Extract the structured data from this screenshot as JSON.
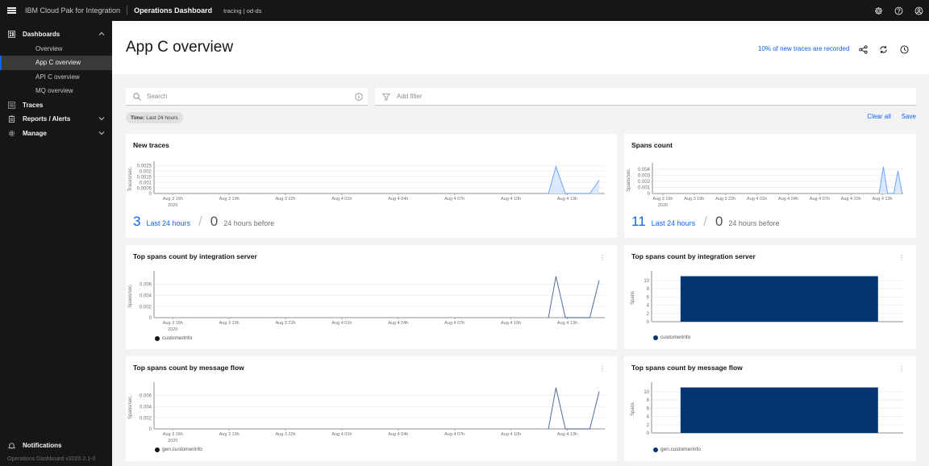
{
  "topbar": {
    "brand": "IBM Cloud Pak for Integration",
    "app_name": "Operations Dashboard",
    "context": "tracing | od-ds",
    "icons": [
      "settings-icon",
      "help-icon",
      "user-icon"
    ]
  },
  "sidebar": {
    "items": [
      {
        "label": "Dashboards",
        "icon": "dashboard-icon",
        "expanded": true,
        "children": [
          {
            "label": "Overview",
            "active": false
          },
          {
            "label": "App C overview",
            "active": true
          },
          {
            "label": "API C overview",
            "active": false
          },
          {
            "label": "MQ overview",
            "active": false
          }
        ]
      },
      {
        "label": "Traces",
        "icon": "traces-icon"
      },
      {
        "label": "Reports / Alerts",
        "icon": "clipboard-icon",
        "expanded": false
      },
      {
        "label": "Manage",
        "icon": "gear-icon",
        "expanded": false
      }
    ],
    "notifications": "Notifications",
    "version": "Operations Dashboard v2020.2.1-0"
  },
  "header": {
    "title": "App C overview",
    "recording_note": "10% of new traces are recorded"
  },
  "toolbar": {
    "search_placeholder": "Search",
    "filter_placeholder": "Add filter",
    "time_tag_key": "Time:",
    "time_tag_value": "Last 24 hours",
    "clear_all": "Clear all",
    "save": "Save"
  },
  "cards": {
    "new_traces": {
      "title": "New traces",
      "count_last": "3",
      "count_last_label": "Last 24 hours",
      "count_before": "0",
      "count_before_label": "24 hours before"
    },
    "spans_count": {
      "title": "Spans count",
      "count_last": "11",
      "count_last_label": "Last 24 hours",
      "count_before": "0",
      "count_before_label": "24 hours before"
    },
    "top_is_line": {
      "title": "Top spans count by integration server",
      "legend": "customerinfo"
    },
    "top_is_bar": {
      "title": "Top spans count by integration server",
      "legend": "customerinfo"
    },
    "top_mf_line": {
      "title": "Top spans count by message flow",
      "legend": "gen.customerinfo"
    },
    "top_mf_bar": {
      "title": "Top spans count by message flow",
      "legend": "gen.customerinfo"
    }
  },
  "colors": {
    "accent": "#0f62fe",
    "area_line": "#6ea6ff",
    "area_fill": "#dbe8fd",
    "series_line": "#4b6e9a",
    "bar": "#033670"
  },
  "chart_data": [
    {
      "id": "new_traces",
      "type": "area",
      "title": "New traces",
      "ylabel": "Traces/sec.",
      "xlabel": "",
      "x_ticks": [
        "Aug 3 16h\n2020",
        "Aug 3 19h",
        "Aug 3 22h",
        "Aug 4 01h",
        "Aug 4 04h",
        "Aug 4 07h",
        "Aug 4 10h",
        "Aug 4 13h"
      ],
      "y_ticks": [
        "0",
        "0.0005",
        "0.001",
        "0.0015",
        "0.002",
        "0.0025"
      ],
      "ylim": [
        0,
        0.0026
      ],
      "x_hours_range": [
        15,
        39
      ],
      "series": [
        {
          "name": "traces",
          "points": [
            [
              36.0,
              0
            ],
            [
              36.4,
              0.0024
            ],
            [
              36.9,
              0
            ],
            [
              38.2,
              0
            ],
            [
              38.7,
              0.0012
            ]
          ]
        }
      ]
    },
    {
      "id": "spans_count",
      "type": "area",
      "title": "Spans count",
      "ylabel": "Spans/sec.",
      "xlabel": "",
      "x_ticks": [
        "Aug 3 16h\n2020",
        "Aug 3 19h",
        "Aug 3 22h",
        "Aug 4 01h",
        "Aug 4 04h",
        "Aug 4 07h",
        "Aug 4 10h",
        "Aug 4 13h"
      ],
      "y_ticks": [
        "0",
        "0.001",
        "0.002",
        "0.003",
        "0.004"
      ],
      "ylim": [
        0,
        0.0045
      ],
      "x_hours_range": [
        15,
        39
      ],
      "series": [
        {
          "name": "spans",
          "points": [
            [
              36.7,
              0
            ],
            [
              37.1,
              0.0044
            ],
            [
              37.5,
              0
            ],
            [
              38.1,
              0
            ],
            [
              38.5,
              0.0037
            ],
            [
              38.9,
              0
            ]
          ]
        }
      ]
    },
    {
      "id": "top_is_line",
      "type": "line",
      "title": "Top spans count by integration server",
      "ylabel": "Spans/sec.",
      "xlabel": "",
      "x_ticks": [
        "Aug 3 16h\n2020",
        "Aug 3 19h",
        "Aug 3 22h",
        "Aug 4 01h",
        "Aug 4 04h",
        "Aug 4 07h",
        "Aug 4 10h",
        "Aug 4 13h"
      ],
      "y_ticks": [
        "0",
        "0.002",
        "0.004",
        "0.006"
      ],
      "ylim": [
        0,
        0.0078
      ],
      "x_hours_range": [
        15,
        39
      ],
      "legend": "bottom-left",
      "series": [
        {
          "name": "customerinfo",
          "points": [
            [
              36.0,
              0
            ],
            [
              36.4,
              0.0074
            ],
            [
              36.9,
              0
            ],
            [
              38.2,
              0
            ],
            [
              38.7,
              0.0067
            ]
          ]
        }
      ]
    },
    {
      "id": "top_is_bar",
      "type": "bar",
      "title": "Top spans count by integration server",
      "ylabel": "Spans",
      "xlabel": "",
      "categories": [
        "customerinfo"
      ],
      "values": [
        11
      ],
      "y_ticks": [
        "0",
        "2",
        "4",
        "6",
        "8",
        "10"
      ],
      "ylim": [
        0,
        11.5
      ],
      "legend": "bottom-left"
    },
    {
      "id": "top_mf_line",
      "type": "line",
      "title": "Top spans count by message flow",
      "ylabel": "Spans/sec.",
      "xlabel": "",
      "x_ticks": [
        "Aug 3 16h\n2020",
        "Aug 3 19h",
        "Aug 3 22h",
        "Aug 4 01h",
        "Aug 4 04h",
        "Aug 4 07h",
        "Aug 4 10h",
        "Aug 4 13h"
      ],
      "y_ticks": [
        "0",
        "0.002",
        "0.004",
        "0.006"
      ],
      "ylim": [
        0,
        0.0078
      ],
      "x_hours_range": [
        15,
        39
      ],
      "legend": "bottom-left",
      "series": [
        {
          "name": "gen.customerinfo",
          "points": [
            [
              36.0,
              0
            ],
            [
              36.4,
              0.0074
            ],
            [
              36.9,
              0
            ],
            [
              38.2,
              0
            ],
            [
              38.7,
              0.0067
            ]
          ]
        }
      ]
    },
    {
      "id": "top_mf_bar",
      "type": "bar",
      "title": "Top spans count by message flow",
      "ylabel": "Spans",
      "xlabel": "",
      "categories": [
        "gen.customerinfo"
      ],
      "values": [
        11
      ],
      "y_ticks": [
        "0",
        "2",
        "4",
        "6",
        "8",
        "10"
      ],
      "ylim": [
        0,
        11.5
      ],
      "legend": "bottom-left"
    }
  ]
}
